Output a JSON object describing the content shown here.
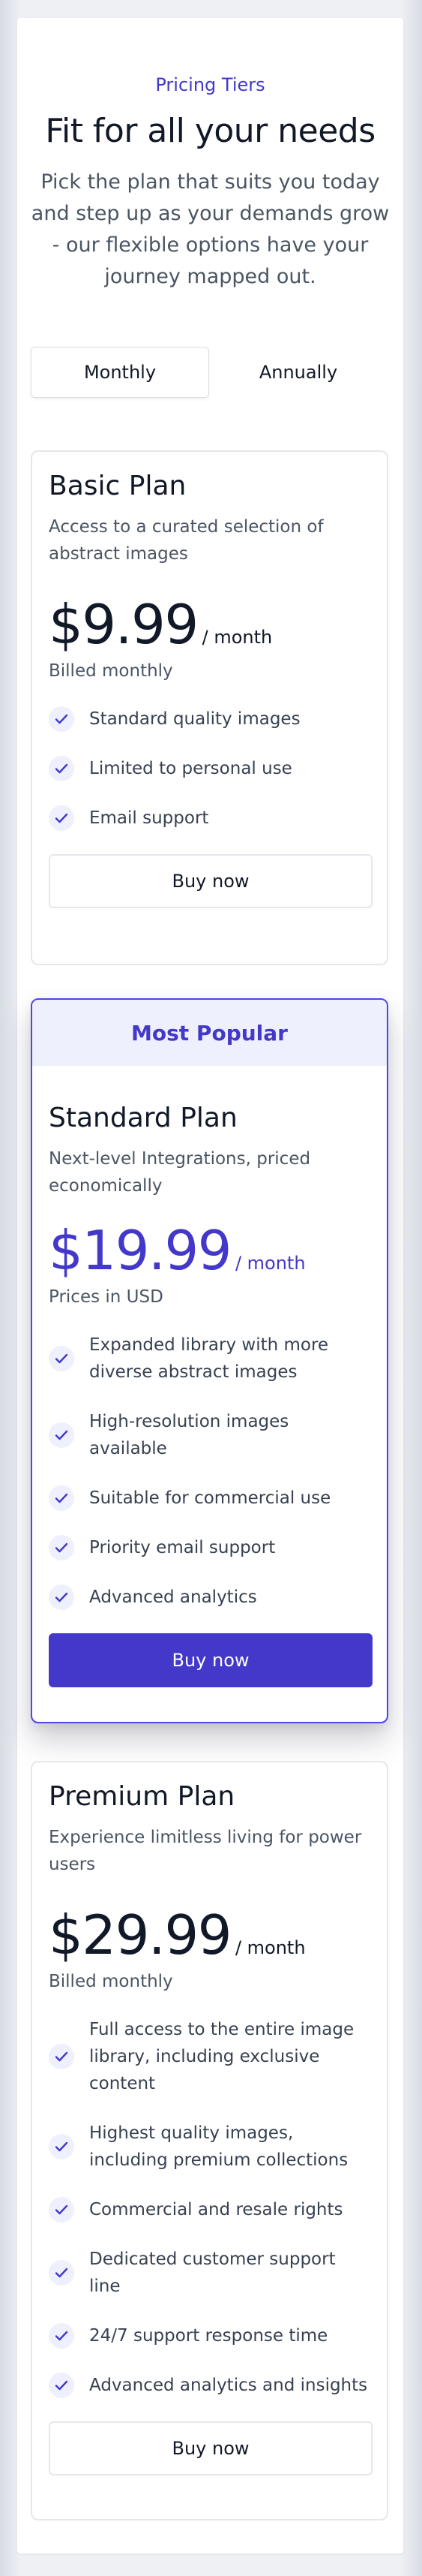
{
  "header": {
    "eyebrow": "Pricing Tiers",
    "title": "Fit for all your needs",
    "subtitle": "Pick the plan that suits you today and step up as your demands grow - our flexible options have your journey mapped out."
  },
  "billing_toggle": {
    "options": [
      "Monthly",
      "Annually"
    ],
    "selected": "Monthly"
  },
  "colors": {
    "accent": "#4338ca",
    "accent_light": "#eef0fe",
    "text": "#111827",
    "muted": "#4b5563",
    "border": "#e5e7eb"
  },
  "plans": [
    {
      "name": "Basic Plan",
      "description": "Access to a curated selection of abstract images",
      "price": "$9.99",
      "period": "/ month",
      "billing": "Billed monthly",
      "features": [
        "Standard quality images",
        "Limited to personal use",
        "Email support"
      ],
      "cta": "Buy now"
    },
    {
      "badge": "Most Popular",
      "name": "Standard Plan",
      "description": "Next-level Integrations, priced economically",
      "price": "$19.99",
      "period": "/ month",
      "billing": "Prices in USD",
      "features": [
        "Expanded library with more diverse abstract images",
        "High-resolution images available",
        "Suitable for commercial use",
        "Priority email support",
        "Advanced analytics"
      ],
      "cta": "Buy now"
    },
    {
      "name": "Premium Plan",
      "description": "Experience limitless living for power users",
      "price": "$29.99",
      "period": "/ month",
      "billing": "Billed monthly",
      "features": [
        "Full access to the entire image library, including exclusive content",
        "Highest quality images, including premium collections",
        "Commercial and resale rights",
        "Dedicated customer support line",
        "24/7 support response time",
        "Advanced analytics and insights"
      ],
      "cta": "Buy now"
    }
  ],
  "icons": {
    "feature_check": "check-icon"
  }
}
